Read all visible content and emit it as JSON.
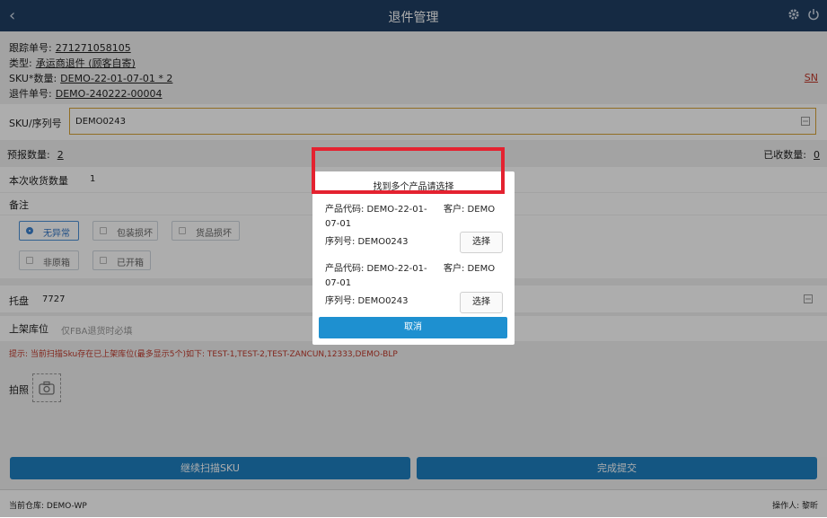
{
  "header": {
    "title": "退件管理"
  },
  "info": {
    "tracking_label": "跟踪单号:",
    "tracking_value": "271271058105",
    "type_label": "类型:",
    "type_value": "承运商退件 (顾客自寄)",
    "sku_qty_label": "SKU*数量:",
    "sku_qty_value": "DEMO-22-01-07-01 * 2",
    "return_no_label": "退件单号:",
    "return_no_value": "DEMO-240222-00004",
    "sn_link": "SN"
  },
  "sku_field": {
    "label": "SKU/序列号",
    "value": "DEMO0243"
  },
  "counts": {
    "forecast_label": "预报数量:",
    "forecast_value": "2",
    "received_label": "已收数量:",
    "received_value": "0"
  },
  "qty_field": {
    "label": "本次收货数量",
    "value": "1"
  },
  "note_field": {
    "label": "备注"
  },
  "options": [
    "无异常",
    "包装损坏",
    "货品损坏",
    "非原箱",
    "已开箱"
  ],
  "tray": {
    "label": "托盘",
    "value": "7727"
  },
  "location": {
    "label": "上架库位",
    "placeholder": "仅FBA退货时必填"
  },
  "hint": "提示: 当前扫描Sku存在已上架库位(最多显示5个)如下:  TEST-1,TEST-2,TEST-ZANCUN,12333,DEMO-BLP",
  "photo": {
    "label": "拍照"
  },
  "buttons": {
    "continue": "继续扫描SKU",
    "submit": "完成提交"
  },
  "footer": {
    "warehouse_label": "当前仓库:",
    "warehouse_value": "DEMO-WP",
    "operator_label": "操作人:",
    "operator_value": "黎昕"
  },
  "modal": {
    "title": "找到多个产品请选择",
    "items": [
      {
        "code": "产品代码: DEMO-22-01-07-01",
        "customer": "客户: DEMO",
        "serial": "序列号: DEMO0243",
        "select": "选择"
      },
      {
        "code": "产品代码: DEMO-22-01-07-01",
        "customer": "客户: DEMO",
        "serial": "序列号: DEMO0243",
        "select": "选择"
      }
    ],
    "cancel": "取消"
  },
  "colors": {
    "header_bg": "#1f3e63",
    "primary": "#1e90d0",
    "highlight_frame": "#e42230"
  }
}
